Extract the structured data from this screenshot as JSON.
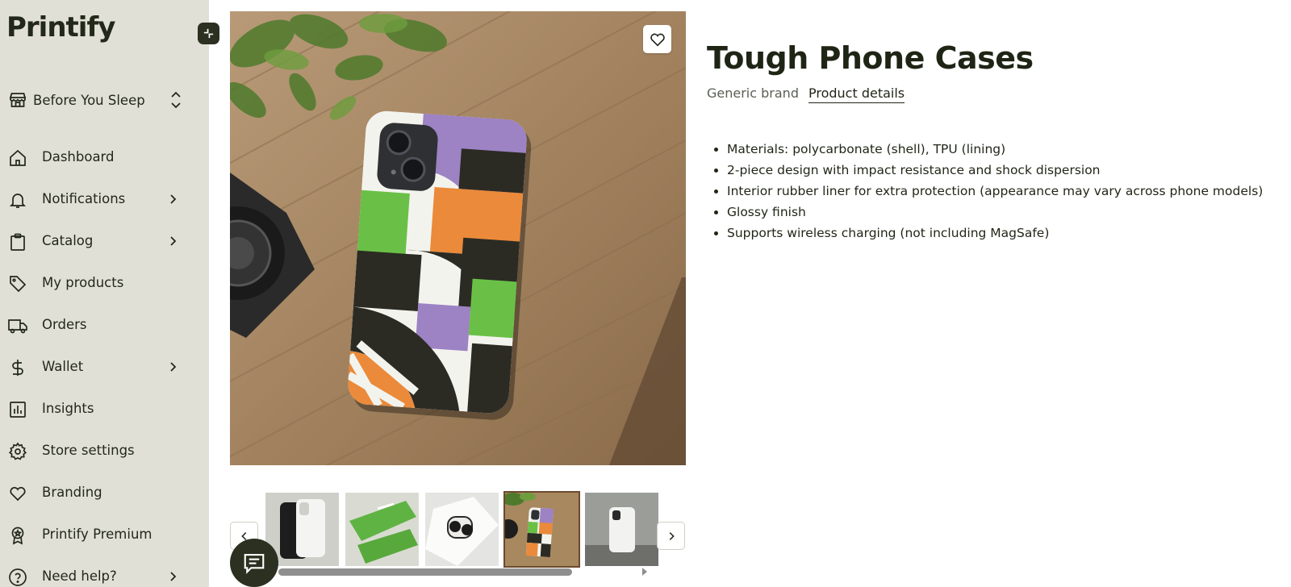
{
  "app": {
    "logo_text": "Printify"
  },
  "sidebar": {
    "store": {
      "name": "Before You Sleep"
    },
    "items": [
      {
        "label": "Dashboard",
        "icon": "home-icon",
        "has_chevron": false
      },
      {
        "label": "Notifications",
        "icon": "bell-icon",
        "has_chevron": true
      },
      {
        "label": "Catalog",
        "icon": "clipboard-icon",
        "has_chevron": true
      },
      {
        "label": "My products",
        "icon": "tag-icon",
        "has_chevron": false
      },
      {
        "label": "Orders",
        "icon": "truck-icon",
        "has_chevron": false
      },
      {
        "label": "Wallet",
        "icon": "dollar-icon",
        "has_chevron": true
      },
      {
        "label": "Insights",
        "icon": "bar-chart-icon",
        "has_chevron": false
      },
      {
        "label": "Store settings",
        "icon": "gear-icon",
        "has_chevron": false
      },
      {
        "label": "Branding",
        "icon": "heart-icon",
        "has_chevron": false
      },
      {
        "label": "Printify Premium",
        "icon": "award-icon",
        "has_chevron": false
      },
      {
        "label": "Need help?",
        "icon": "help-icon",
        "has_chevron": true
      }
    ]
  },
  "product": {
    "title": "Tough Phone Cases",
    "brand": "Generic brand",
    "details_link": "Product details",
    "specs": [
      "Materials: polycarbonate (shell), TPU (lining)",
      "2-piece design with impact resistance and shock dispersion",
      "Interior rubber liner for extra protection (appearance may vary across phone models)",
      "Glossy finish",
      "Supports wireless charging (not including MagSafe)"
    ],
    "thumbnail_count": 5,
    "selected_thumbnail": 4
  },
  "colors": {
    "sidebar_bg": "#e1e0d7",
    "brand_dark": "#2b3020",
    "text": "#1f2515"
  }
}
